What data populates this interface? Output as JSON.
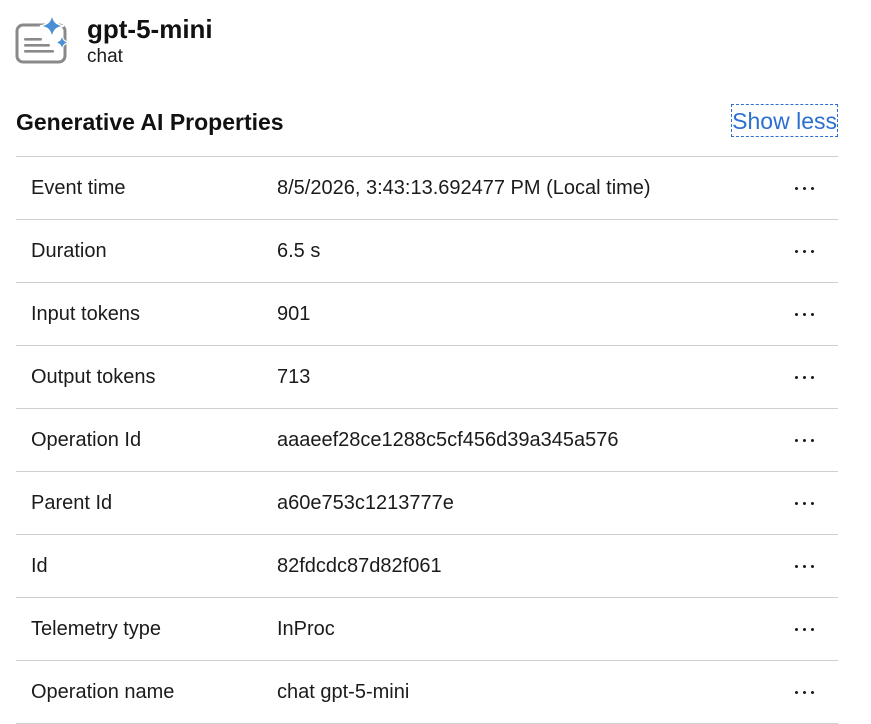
{
  "header": {
    "icon": "sparkle-chat-icon",
    "model_name": "gpt-5-mini",
    "model_kind": "chat"
  },
  "section": {
    "title": "Generative AI Properties",
    "toggle_label": "Show less"
  },
  "properties": [
    {
      "key": "Event time",
      "value": "8/5/2026, 3:43:13.692477 PM (Local time)"
    },
    {
      "key": "Duration",
      "value": "6.5 s"
    },
    {
      "key": "Input tokens",
      "value": "901"
    },
    {
      "key": "Output tokens",
      "value": "713"
    },
    {
      "key": "Operation Id",
      "value": "aaaeef28ce1288c5cf456d39a345a576"
    },
    {
      "key": "Parent Id",
      "value": "a60e753c1213777e"
    },
    {
      "key": "Id",
      "value": "82fdcdc87d82f061"
    },
    {
      "key": "Telemetry type",
      "value": "InProc"
    },
    {
      "key": "Operation name",
      "value": "chat gpt-5-mini"
    }
  ],
  "colors": {
    "link": "#2b6fd1",
    "sparkle": "#4a8fd4",
    "icon_frame": "#8a8a8a",
    "divider": "#cfcfcf"
  }
}
